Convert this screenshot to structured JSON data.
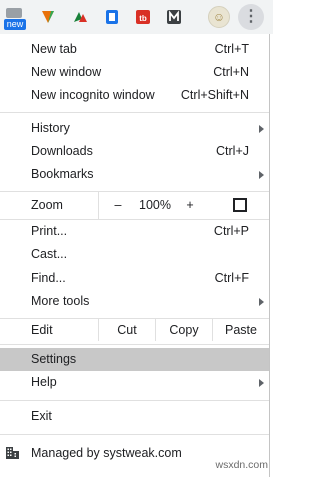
{
  "toolbar": {
    "new_badge": "new",
    "extensions": [
      "new-extension-icon",
      "grammar-extension-icon",
      "av-extension-icon",
      "translate-extension-icon",
      "tb-extension-icon",
      "m-extension-icon"
    ],
    "avatar_icon": "profile-avatar-icon",
    "menu_icon": "more-vert-icon"
  },
  "menu": {
    "new_tab": {
      "label": "New tab",
      "shortcut": "Ctrl+T"
    },
    "new_window": {
      "label": "New window",
      "shortcut": "Ctrl+N"
    },
    "new_incognito": {
      "label": "New incognito window",
      "shortcut": "Ctrl+Shift+N"
    },
    "history": {
      "label": "History"
    },
    "downloads": {
      "label": "Downloads",
      "shortcut": "Ctrl+J"
    },
    "bookmarks": {
      "label": "Bookmarks"
    },
    "zoom": {
      "label": "Zoom",
      "minus": "–",
      "value": "100%",
      "plus": "+"
    },
    "print": {
      "label": "Print...",
      "shortcut": "Ctrl+P"
    },
    "cast": {
      "label": "Cast..."
    },
    "find": {
      "label": "Find...",
      "shortcut": "Ctrl+F"
    },
    "more_tools": {
      "label": "More tools"
    },
    "edit": {
      "label": "Edit",
      "cut": "Cut",
      "copy": "Copy",
      "paste": "Paste"
    },
    "settings": {
      "label": "Settings"
    },
    "help": {
      "label": "Help"
    },
    "exit": {
      "label": "Exit"
    },
    "managed": {
      "label": "Managed by systweak.com"
    }
  },
  "watermark": "wsxdn.com",
  "colors": {
    "selected_bg": "#c8c8c8",
    "accent": "#1a73e8",
    "separator": "#e0e0e0"
  }
}
